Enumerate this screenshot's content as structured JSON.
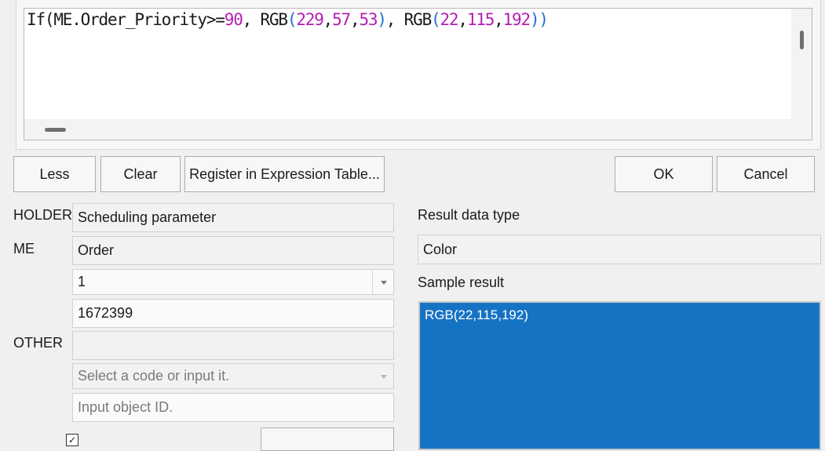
{
  "editor": {
    "expression_tokens": [
      {
        "text": "If(ME.Order_Priority>=",
        "kind": "plain"
      },
      {
        "text": "90",
        "kind": "num"
      },
      {
        "text": ", RGB",
        "kind": "plain"
      },
      {
        "text": "(",
        "kind": "paren"
      },
      {
        "text": "229",
        "kind": "num"
      },
      {
        "text": ",",
        "kind": "plain"
      },
      {
        "text": "57",
        "kind": "num"
      },
      {
        "text": ",",
        "kind": "plain"
      },
      {
        "text": "53",
        "kind": "num"
      },
      {
        "text": ")",
        "kind": "paren"
      },
      {
        "text": ", RGB",
        "kind": "plain"
      },
      {
        "text": "(",
        "kind": "paren"
      },
      {
        "text": "22",
        "kind": "num"
      },
      {
        "text": ",",
        "kind": "plain"
      },
      {
        "text": "115",
        "kind": "num"
      },
      {
        "text": ",",
        "kind": "plain"
      },
      {
        "text": "192",
        "kind": "num"
      },
      {
        "text": "))",
        "kind": "paren"
      }
    ]
  },
  "buttons": {
    "less": "Less",
    "clear": "Clear",
    "register": "Register in Expression Table...",
    "ok": "OK",
    "cancel": "Cancel"
  },
  "holder": {
    "label": "HOLDER",
    "value": "Scheduling parameter"
  },
  "me": {
    "label": "ME",
    "value": "Order",
    "index_value": "1",
    "id_value": "1672399"
  },
  "other": {
    "label": "OTHER",
    "value": "",
    "code_placeholder": "Select a code or input it.",
    "id_placeholder": "Input object ID."
  },
  "result": {
    "type_label": "Result data type",
    "type_value": "Color",
    "sample_label": "Sample result",
    "sample_value": "RGB(22,115,192)"
  },
  "colors": {
    "sample_background": "#1673c4",
    "number_token": "#b21fb2",
    "paren_token": "#1f6fd1"
  }
}
